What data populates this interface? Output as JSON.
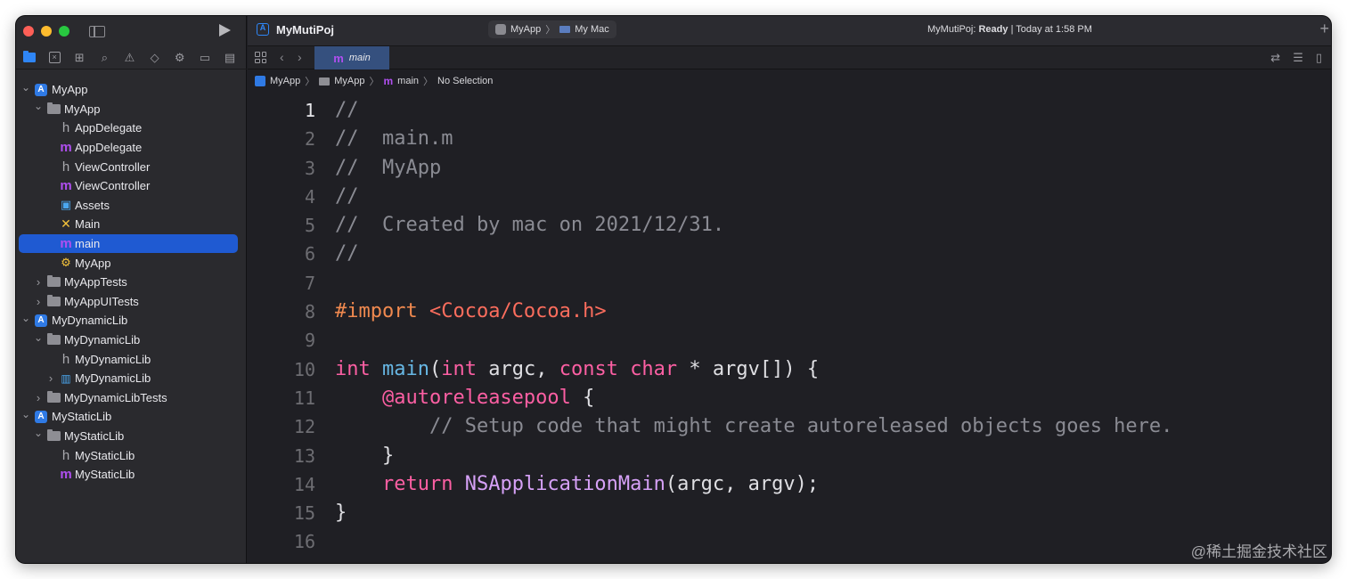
{
  "window": {
    "project_title": "MyMutiPoj",
    "scheme": {
      "target": "MyApp",
      "destination": "My Mac"
    },
    "status": {
      "project": "MyMutiPoj:",
      "state": "Ready",
      "time": "| Today at 1:58 PM"
    }
  },
  "colors": {
    "close": "#fe5f57",
    "minimize": "#febc2e",
    "zoom": "#28c840",
    "selection": "#1f5ad2",
    "accent": "#2f86f6"
  },
  "navigator_tabs": [
    {
      "icon": "folder-icon",
      "active": true
    },
    {
      "icon": "source-control-icon"
    },
    {
      "icon": "hierarchy-icon"
    },
    {
      "icon": "search-icon"
    },
    {
      "icon": "warning-icon"
    },
    {
      "icon": "test-icon"
    },
    {
      "icon": "debug-icon"
    },
    {
      "icon": "breakpoint-icon"
    },
    {
      "icon": "report-icon"
    }
  ],
  "tree": [
    {
      "label": "MyApp",
      "kind": "project",
      "depth": 0,
      "chevron": "down"
    },
    {
      "label": "MyApp",
      "kind": "group",
      "depth": 1,
      "chevron": "down"
    },
    {
      "label": "AppDelegate",
      "kind": "h",
      "depth": 2
    },
    {
      "label": "AppDelegate",
      "kind": "m",
      "depth": 2
    },
    {
      "label": "ViewController",
      "kind": "h",
      "depth": 2
    },
    {
      "label": "ViewController",
      "kind": "m",
      "depth": 2
    },
    {
      "label": "Assets",
      "kind": "assets",
      "depth": 2
    },
    {
      "label": "Main",
      "kind": "storyboard",
      "depth": 2
    },
    {
      "label": "main",
      "kind": "m",
      "depth": 2,
      "selected": true
    },
    {
      "label": "MyApp",
      "kind": "entitlements",
      "depth": 2
    },
    {
      "label": "MyAppTests",
      "kind": "group",
      "depth": 1,
      "chevron": "right"
    },
    {
      "label": "MyAppUITests",
      "kind": "group",
      "depth": 1,
      "chevron": "right"
    },
    {
      "label": "MyDynamicLib",
      "kind": "project",
      "depth": 0,
      "chevron": "down"
    },
    {
      "label": "MyDynamicLib",
      "kind": "group",
      "depth": 1,
      "chevron": "down"
    },
    {
      "label": "MyDynamicLib",
      "kind": "h",
      "depth": 2
    },
    {
      "label": "MyDynamicLib",
      "kind": "framework",
      "depth": 2,
      "chevron": "right"
    },
    {
      "label": "MyDynamicLibTests",
      "kind": "group",
      "depth": 1,
      "chevron": "right"
    },
    {
      "label": "MyStaticLib",
      "kind": "project",
      "depth": 0,
      "chevron": "down"
    },
    {
      "label": "MyStaticLib",
      "kind": "group",
      "depth": 1,
      "chevron": "down"
    },
    {
      "label": "MyStaticLib",
      "kind": "h",
      "depth": 2
    },
    {
      "label": "MyStaticLib",
      "kind": "m",
      "depth": 2
    }
  ],
  "editor": {
    "tab_label": "main",
    "jumpbar": [
      "MyApp",
      "MyApp",
      "main",
      "No Selection"
    ],
    "current_line": 1,
    "lines": [
      {
        "n": "1",
        "tokens": [
          [
            "c-comment",
            "//"
          ]
        ]
      },
      {
        "n": "2",
        "tokens": [
          [
            "c-comment",
            "//  main.m"
          ]
        ]
      },
      {
        "n": "3",
        "tokens": [
          [
            "c-comment",
            "//  MyApp"
          ]
        ]
      },
      {
        "n": "4",
        "tokens": [
          [
            "c-comment",
            "//"
          ]
        ]
      },
      {
        "n": "5",
        "tokens": [
          [
            "c-comment",
            "//  Created by mac on 2021/12/31."
          ]
        ]
      },
      {
        "n": "6",
        "tokens": [
          [
            "c-comment",
            "//"
          ]
        ]
      },
      {
        "n": "7",
        "tokens": []
      },
      {
        "n": "8",
        "tokens": [
          [
            "c-pre",
            "#import "
          ],
          [
            "c-str",
            "<Cocoa/Cocoa.h>"
          ]
        ]
      },
      {
        "n": "9",
        "tokens": []
      },
      {
        "n": "10",
        "tokens": [
          [
            "c-kw",
            "int"
          ],
          [
            "c-plain",
            " "
          ],
          [
            "c-fn",
            "main"
          ],
          [
            "c-plain",
            "("
          ],
          [
            "c-kw",
            "int"
          ],
          [
            "c-plain",
            " argc, "
          ],
          [
            "c-kw",
            "const"
          ],
          [
            "c-plain",
            " "
          ],
          [
            "c-kw",
            "char"
          ],
          [
            "c-plain",
            " * argv[]) {"
          ]
        ]
      },
      {
        "n": "11",
        "tokens": [
          [
            "c-plain",
            "    "
          ],
          [
            "c-kw",
            "@autoreleasepool"
          ],
          [
            "c-plain",
            " {"
          ]
        ]
      },
      {
        "n": "12",
        "tokens": [
          [
            "c-plain",
            "        "
          ],
          [
            "c-comment",
            "// Setup code that might create autoreleased objects goes here."
          ]
        ]
      },
      {
        "n": "13",
        "tokens": [
          [
            "c-plain",
            "    }"
          ]
        ]
      },
      {
        "n": "14",
        "tokens": [
          [
            "c-plain",
            "    "
          ],
          [
            "c-kw",
            "return"
          ],
          [
            "c-plain",
            " "
          ],
          [
            "c-type",
            "NSApplicationMain"
          ],
          [
            "c-plain",
            "(argc, argv);"
          ]
        ]
      },
      {
        "n": "15",
        "tokens": [
          [
            "c-plain",
            "}"
          ]
        ]
      },
      {
        "n": "16",
        "tokens": []
      }
    ]
  },
  "watermark": "@稀土掘金技术社区"
}
